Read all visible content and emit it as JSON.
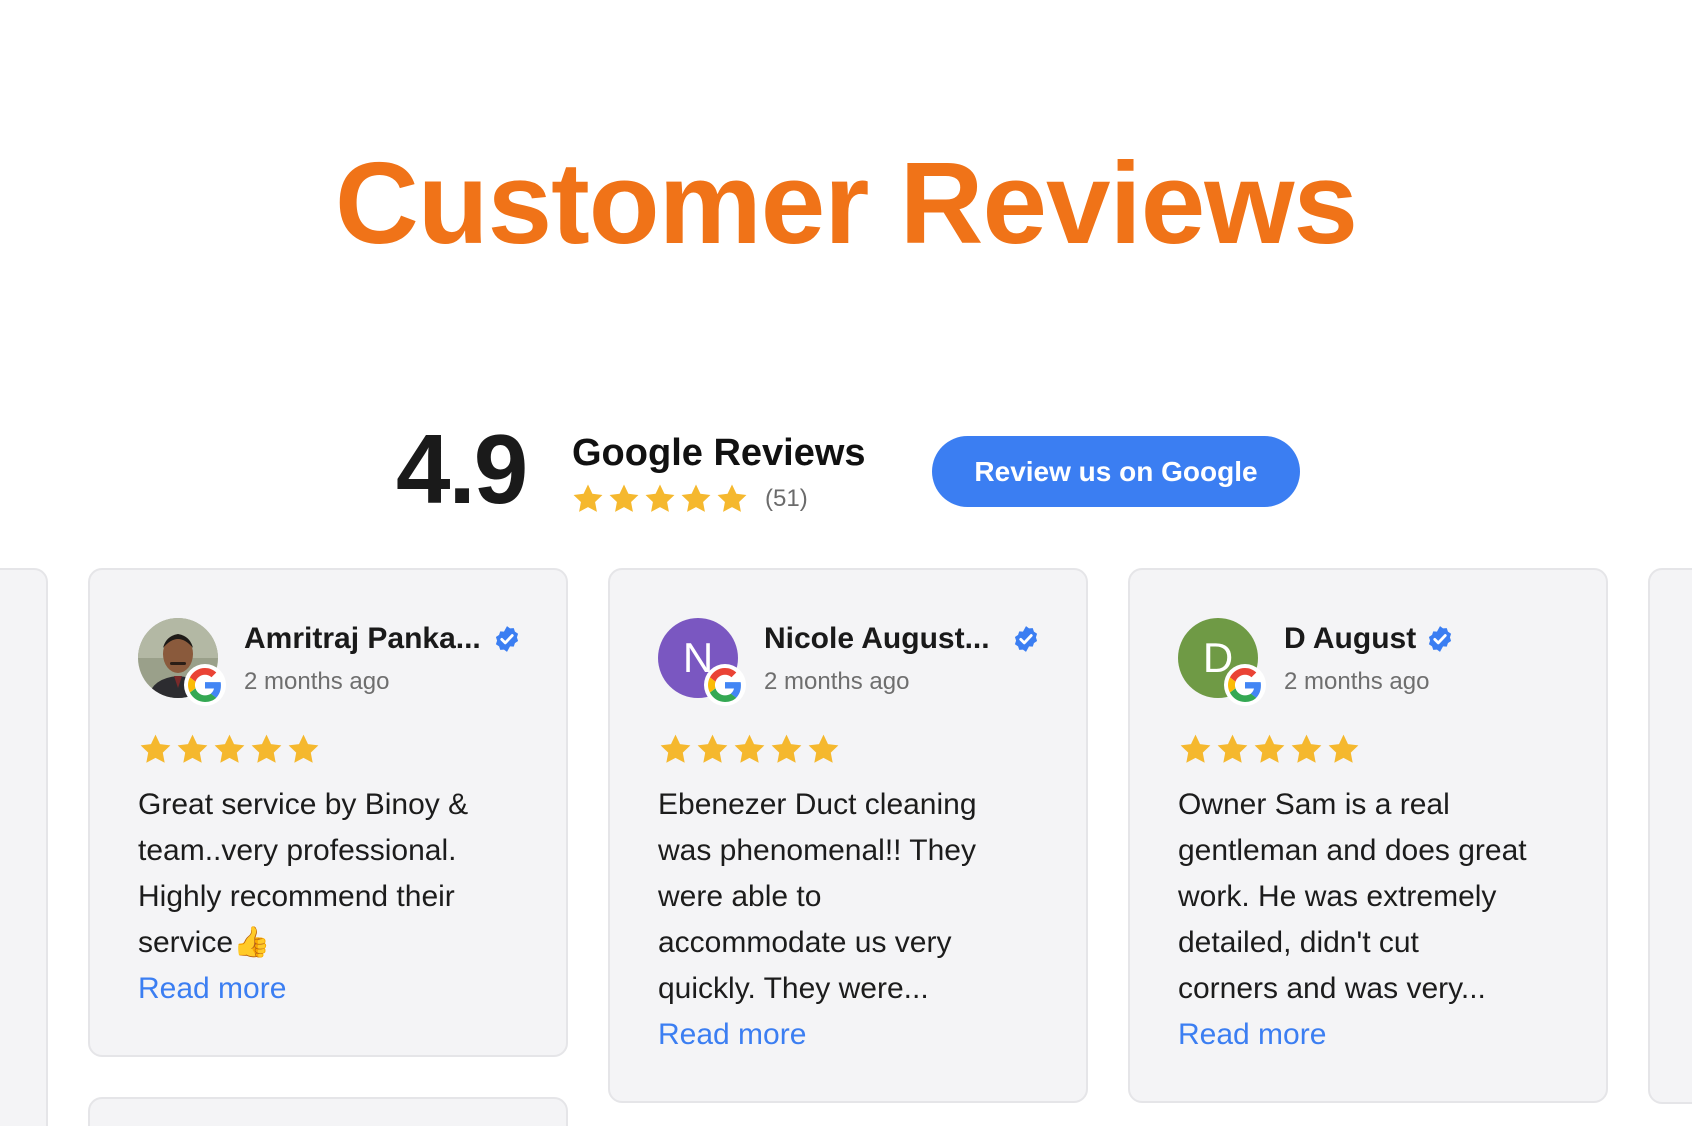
{
  "page": {
    "title": "Customer Reviews"
  },
  "summary": {
    "rating": "4.9",
    "title": "Google Reviews",
    "stars": 5,
    "count": "(51)",
    "button_label": "Review us on Google"
  },
  "colors": {
    "title": "#f07318",
    "button": "#3b7ef2",
    "star": "#f5b82e",
    "link": "#3b7ef2",
    "card_bg": "#f4f4f6"
  },
  "reviews": [
    {
      "name": "Amritraj Panka...",
      "date": "2 months ago",
      "rating": 5,
      "avatar_initial": "",
      "avatar_type": "photo",
      "text_lines": [
        "Great service by Binoy &",
        "team..very professional.",
        "Highly recommend their",
        "service👍"
      ],
      "read_more": "Read more"
    },
    {
      "name": "Nicole August...",
      "date": "2 months ago",
      "rating": 5,
      "avatar_initial": "N",
      "avatar_color": "#7a57c1",
      "text_lines": [
        "Ebenezer Duct cleaning",
        "was phenomenal!! They",
        "were able to",
        "accommodate us very",
        "quickly. They were..."
      ],
      "read_more": "Read more"
    },
    {
      "name": "D August",
      "date": "2 months ago",
      "rating": 5,
      "avatar_initial": "D",
      "avatar_color": "#6f9a45",
      "text_lines": [
        "Owner Sam is a real",
        "gentleman and does great",
        "work. He was extremely",
        "detailed, didn't cut",
        "corners and was very..."
      ],
      "read_more": "Read more"
    }
  ]
}
